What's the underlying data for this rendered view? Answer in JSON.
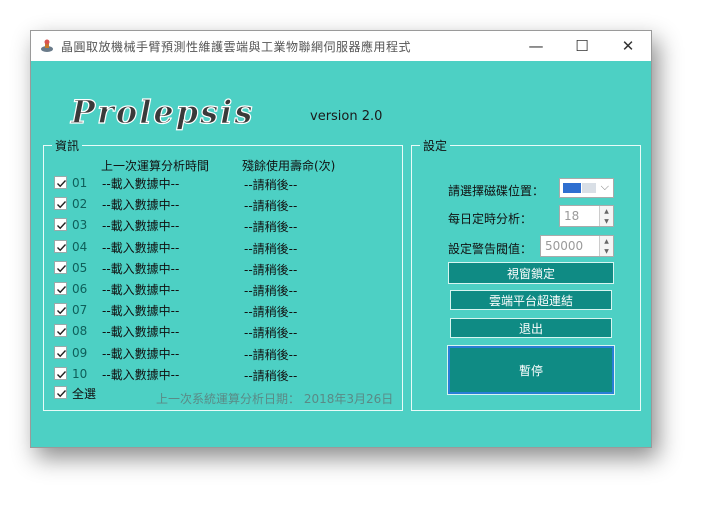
{
  "window": {
    "title": "晶圓取放機械手臂預測性維護雲端與工業物聯網伺服器應用程式",
    "minimize": "—",
    "maximize": "☐",
    "close": "✕"
  },
  "header": {
    "logo_text": "Prolepsis",
    "version": "version 2.0"
  },
  "info": {
    "group_title": "資訊",
    "col_last_analysis": "上一次運算分析時間",
    "col_remaining_life": "殘餘使用壽命(次)",
    "rows": [
      {
        "num": "01",
        "last": "--載入數據中--",
        "life": "--請稍後--"
      },
      {
        "num": "02",
        "last": "--載入數據中--",
        "life": "--請稍後--"
      },
      {
        "num": "03",
        "last": "--載入數據中--",
        "life": "--請稍後--"
      },
      {
        "num": "04",
        "last": "--載入數據中--",
        "life": "--請稍後--"
      },
      {
        "num": "05",
        "last": "--載入數據中--",
        "life": "--請稍後--"
      },
      {
        "num": "06",
        "last": "--載入數據中--",
        "life": "--請稍後--"
      },
      {
        "num": "07",
        "last": "--載入數據中--",
        "life": "--請稍後--"
      },
      {
        "num": "08",
        "last": "--載入數據中--",
        "life": "--請稍後--"
      },
      {
        "num": "09",
        "last": "--載入數據中--",
        "life": "--請稍後--"
      },
      {
        "num": "10",
        "last": "--載入數據中--",
        "life": "--請稍後--"
      }
    ],
    "select_all": "全選",
    "last_system_analysis": "上一次系統運算分析日期：  2018年3月26日"
  },
  "settings": {
    "group_title": "設定",
    "disk_label": "請選擇磁碟位置：",
    "daily_label": "每日定時分析：",
    "daily_value": "18",
    "threshold_label": "設定警告閥值：",
    "threshold_value": "50000",
    "btn_lock": "視窗鎖定",
    "btn_cloud": "雲端平台超連結",
    "btn_exit": "退出",
    "btn_pause": "暫停",
    "disk_swatch_color": "#2f6fd0"
  }
}
